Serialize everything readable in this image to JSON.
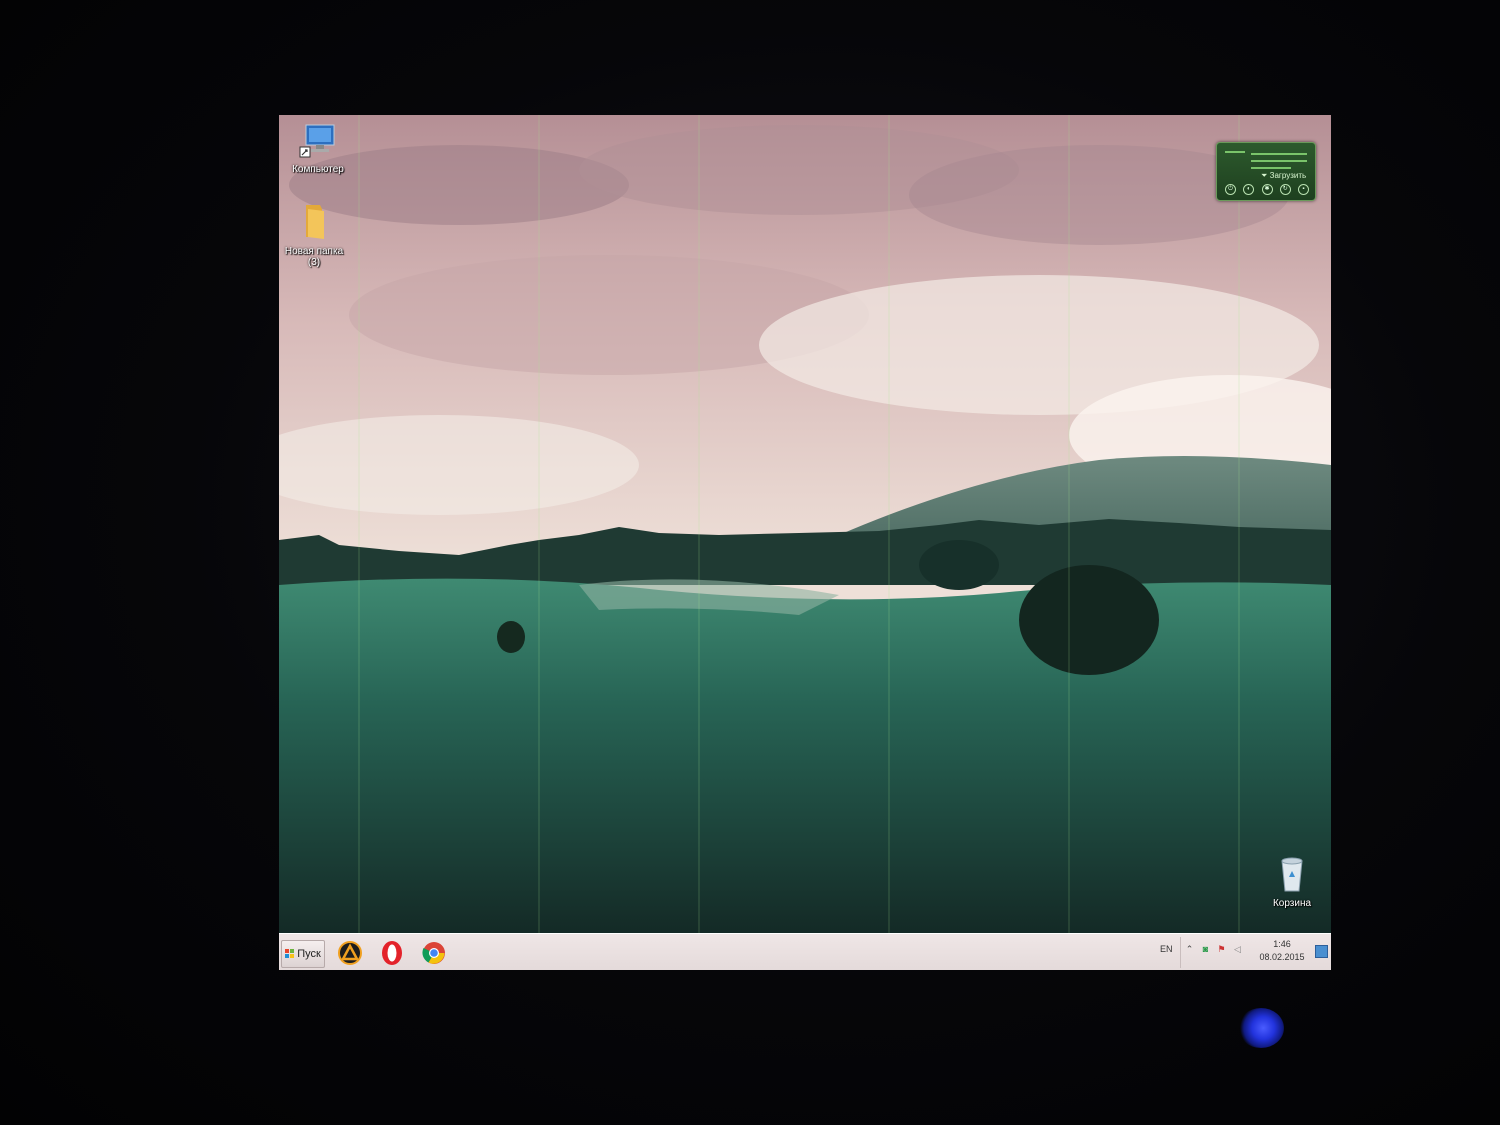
{
  "desktop": {
    "icons": [
      {
        "label": "Компьютер",
        "icon": "computer-icon"
      },
      {
        "label": "Новая папка",
        "sublabel": "(3)",
        "icon": "folder-icon"
      },
      {
        "label": "Корзина",
        "icon": "recycle-bin-icon"
      }
    ]
  },
  "gadget": {
    "button_label": "Загрузить",
    "status_symbol": "⏷"
  },
  "taskbar": {
    "start_label": "Пуск",
    "pinned_apps": [
      {
        "icon": "aimp-icon"
      },
      {
        "icon": "opera-icon"
      },
      {
        "icon": "chrome-icon"
      }
    ],
    "language": "EN",
    "tray_icons": [
      "expand-tray-icon",
      "network-icon",
      "flag-icon",
      "volume-icon"
    ],
    "time": "1:46",
    "date": "08.02.2015"
  },
  "colors": {
    "taskbar_bg": "#e8dede",
    "gadget_bg": "#2d5a2d",
    "power_led": "#3344ff"
  }
}
